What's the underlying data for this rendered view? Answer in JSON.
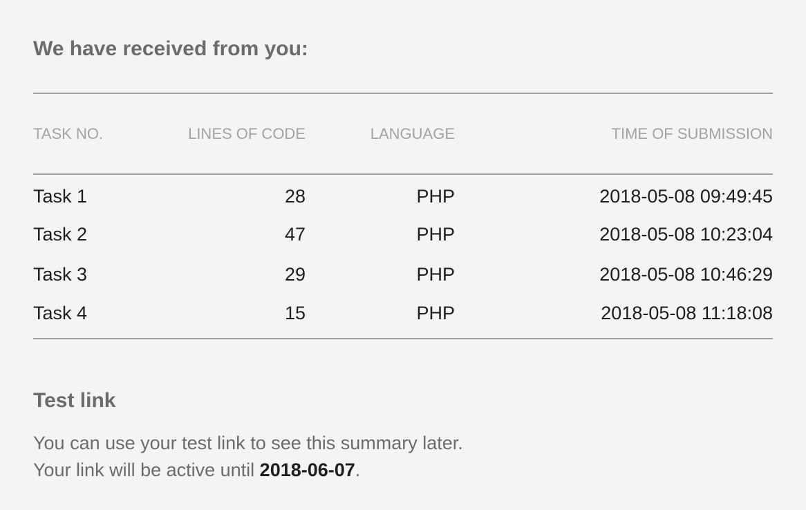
{
  "heading": "We have received from you:",
  "table": {
    "headers": {
      "task": "TASK NO.",
      "lines": "LINES OF CODE",
      "language": "LANGUAGE",
      "time": "TIME OF SUBMISSION"
    },
    "rows": [
      {
        "task": "Task 1",
        "lines": "28",
        "language": "PHP",
        "time": "2018-05-08 09:49:45"
      },
      {
        "task": "Task 2",
        "lines": "47",
        "language": "PHP",
        "time": "2018-05-08 10:23:04"
      },
      {
        "task": "Task 3",
        "lines": "29",
        "language": "PHP",
        "time": "2018-05-08 10:46:29"
      },
      {
        "task": "Task 4",
        "lines": "15",
        "language": "PHP",
        "time": "2018-05-08 11:18:08"
      }
    ]
  },
  "test_link": {
    "heading": "Test link",
    "line1": "You can use your test link to see this summary later.",
    "line2_prefix": "Your link will be active until ",
    "expiry_date": "2018-06-07",
    "line2_suffix": "."
  },
  "colors": {
    "background": "#f4f4f4",
    "heading": "#6b6b6b",
    "header_text": "#a3a3a3",
    "cell_text": "#1e1e1e",
    "rule": "#a0a0a0"
  }
}
